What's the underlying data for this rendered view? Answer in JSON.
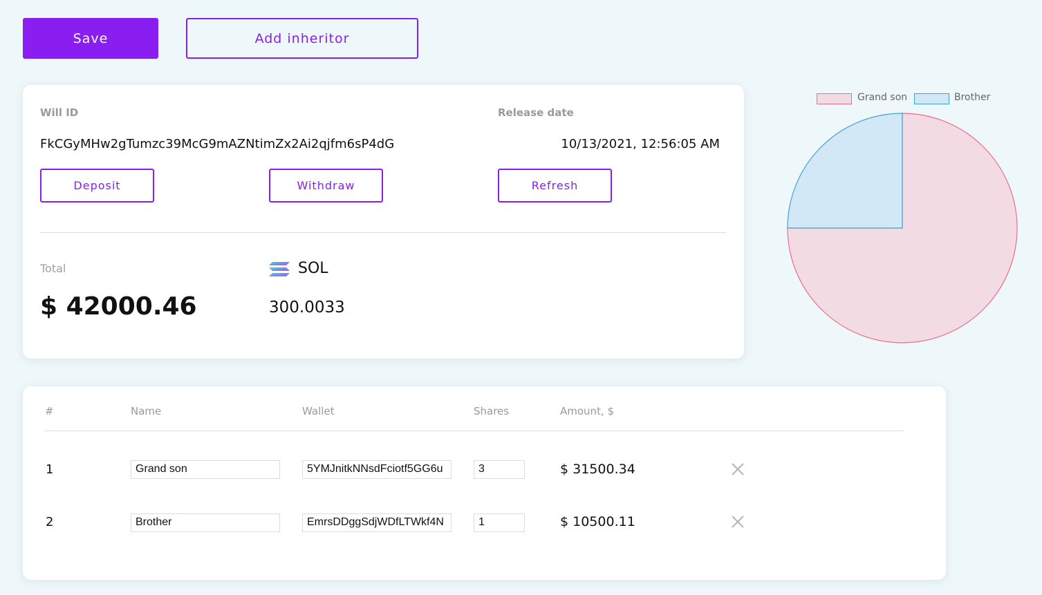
{
  "toolbar": {
    "save_label": "Save",
    "add_inheritor_label": "Add inheritor"
  },
  "will": {
    "id_label": "Will ID",
    "id_value": "FkCGyMHw2gTumzc39McG9mAZNtimZx2Ai2qjfm6sP4dG",
    "release_label": "Release date",
    "release_value": "10/13/2021, 12:56:05 AM",
    "deposit_label": "Deposit",
    "withdraw_label": "Withdraw",
    "refresh_label": "Refresh",
    "total_label": "Total",
    "total_value": "$ 42000.46",
    "token_icon": "solana-icon",
    "token_name": "SOL",
    "token_amount": "300.0033"
  },
  "chart_data": {
    "type": "pie",
    "labels": [
      "Grand son",
      "Brother"
    ],
    "values": [
      3,
      1
    ],
    "colors": {
      "fill": [
        "#f3dbe3",
        "#d2e8f6"
      ],
      "stroke": [
        "#f06b8d",
        "#3ea2d8"
      ]
    },
    "legend": "top"
  },
  "table": {
    "headers": [
      "#",
      "Name",
      "Wallet",
      "Shares",
      "Amount, $"
    ],
    "rows": [
      {
        "num": "1",
        "name": "Grand son",
        "wallet": "5YMJnitkNNsdFciotf5GG6u",
        "shares": "3",
        "amount": "$ 31500.34"
      },
      {
        "num": "2",
        "name": "Brother",
        "wallet": "EmrsDDggSdjWDfLTWkf4N",
        "shares": "1",
        "amount": "$ 10500.11"
      }
    ],
    "remove_icon": "close-icon"
  }
}
